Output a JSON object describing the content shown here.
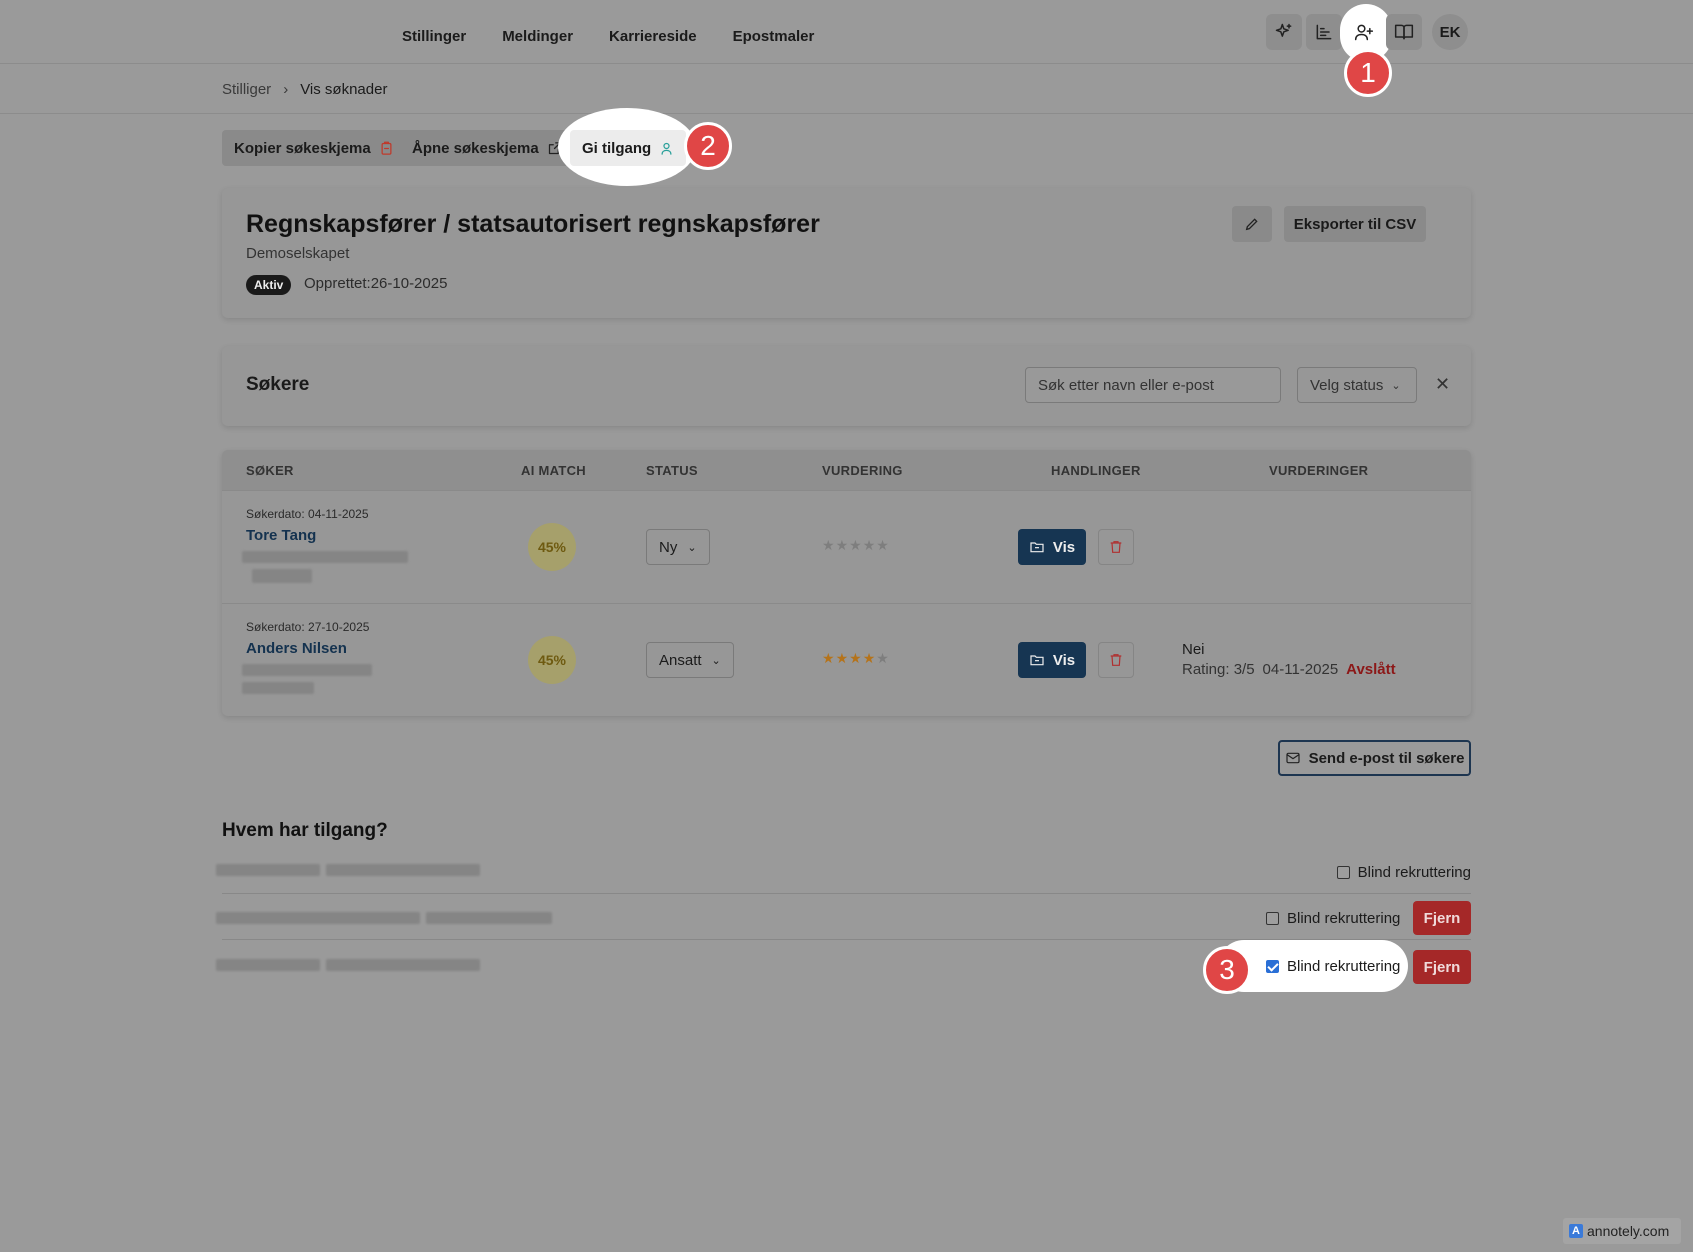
{
  "nav": {
    "items": [
      "Stillinger",
      "Meldinger",
      "Karriereside",
      "Epostmaler"
    ]
  },
  "header": {
    "icons": [
      "sparkles-icon",
      "chart-bars-icon",
      "user-plus-icon",
      "book-icon"
    ],
    "avatar_initials": "EK"
  },
  "markers": {
    "m1": "1",
    "m2": "2",
    "m3": "3"
  },
  "breadcrumb": {
    "parent": "Stilliger",
    "separator": "›",
    "current": "Vis søknader"
  },
  "actions": {
    "copy_form": "Kopier søkeskjema",
    "open_form": "Åpne søkeskjema",
    "give_access": "Gi tilgang"
  },
  "job": {
    "title": "Regnskapsfører / statsautorisert regnskapsfører",
    "company": "Demoselskapet",
    "status_badge": "Aktiv",
    "created": "Opprettet:26-10-2025",
    "export_label": "Eksporter til CSV"
  },
  "applicants_panel": {
    "title": "Søkere",
    "search_placeholder": "Søk etter navn eller e-post",
    "status_filter": "Velg status"
  },
  "table": {
    "headers": [
      "SØKER",
      "AI MATCH",
      "STATUS",
      "VURDERING",
      "HANDLINGER",
      "VURDERINGER"
    ],
    "rows": [
      {
        "date": "Søkerdato: 04-11-2025",
        "name": "Tore Tang",
        "match": "45%",
        "status": "Ny",
        "rating": 0,
        "view_label": "Vis",
        "review_answer": "",
        "review_rating": "",
        "review_date": "",
        "review_result": ""
      },
      {
        "date": "Søkerdato: 27-10-2025",
        "name": "Anders Nilsen",
        "match": "45%",
        "status": "Ansatt",
        "rating": 4,
        "view_label": "Vis",
        "review_answer": "Nei",
        "review_rating": "Rating: 3/5",
        "review_date": "04-11-2025",
        "review_result": "Avslått"
      }
    ]
  },
  "send_email_label": "Send e-post til søkere",
  "access": {
    "title": "Hvem har tilgang?",
    "rows": [
      {
        "blind_label": "Blind rekruttering",
        "checked": false,
        "remove_label": ""
      },
      {
        "blind_label": "Blind rekruttering",
        "checked": false,
        "remove_label": "Fjern"
      },
      {
        "blind_label": "Blind rekruttering",
        "checked": true,
        "remove_label": "Fjern"
      }
    ]
  },
  "watermark": "annotely.com",
  "colors": {
    "accent_navy": "#163552",
    "danger": "#a52828",
    "rejected": "#8c1818",
    "marker_red": "#e04646"
  }
}
